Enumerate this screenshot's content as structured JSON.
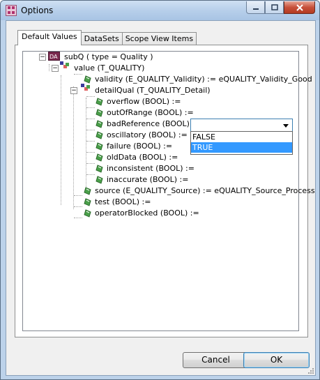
{
  "window": {
    "title": "Options"
  },
  "tabs": [
    "Default Values",
    "DataSets",
    "Scope View Items"
  ],
  "tree": {
    "root": "subQ ( type = Quality )",
    "value": "value (T_QUALITY)",
    "validity": "validity (E_QUALITY_Validity) := eQUALITY_Validity_Good",
    "detailQual": "detailQual (T_QUALITY_Detail)",
    "detail_items": [
      "overflow (BOOL) :=",
      "outOfRange (BOOL) :=",
      "badReference (BOOL) :=",
      "oscillatory (BOOL) :=",
      "failure (BOOL) :=",
      "oldData (BOOL) :=",
      "inconsistent (BOOL) :=",
      "inaccurate (BOOL) :="
    ],
    "source": "source (E_QUALITY_Source) := eQUALITY_Source_Process",
    "test": "test (BOOL) :=",
    "operatorBlocked": "operatorBlocked (BOOL) :="
  },
  "dropdown": {
    "value": "",
    "options": [
      "FALSE",
      "TRUE"
    ],
    "highlighted": "TRUE"
  },
  "buttons": {
    "cancel": "Cancel",
    "ok": "OK"
  },
  "colors": {
    "selection": "#3399ff",
    "title_gradient": "#b7cfea"
  }
}
